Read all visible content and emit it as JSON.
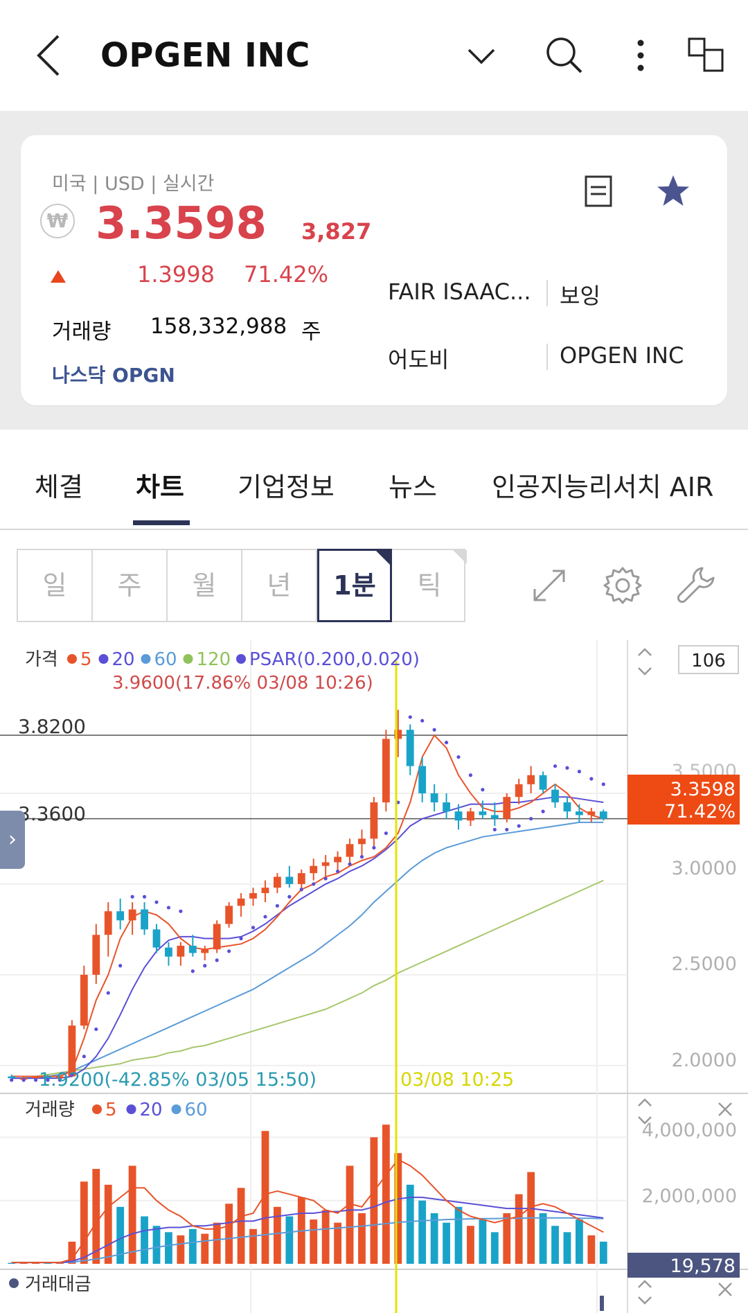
{
  "header": {
    "title": "OPGEN INC",
    "icons": [
      "back-arrow-icon",
      "chevron-down-icon",
      "search-icon",
      "more-vertical-icon",
      "window-switch-icon"
    ]
  },
  "quote": {
    "market": "미국 | USD | 실시간",
    "currency_badge": "₩",
    "price": "3.3598",
    "price_krw": "3,827",
    "change": "1.3998",
    "change_pct": "71.42%",
    "volume_label": "거래량",
    "volume": "158,332,988",
    "volume_unit": "주",
    "exchange_ticker": "나스닥 OPGN",
    "up_color": "#d8434c"
  },
  "related": [
    "FAIR ISAAC...",
    "보잉",
    "어도비",
    "OPGEN INC"
  ],
  "tabs": [
    {
      "label": "체결",
      "active": false
    },
    {
      "label": "차트",
      "active": true
    },
    {
      "label": "기업정보",
      "active": false
    },
    {
      "label": "뉴스",
      "active": false
    },
    {
      "label": "인공지능리서치 AIR",
      "active": false
    }
  ],
  "periods": [
    {
      "label": "일",
      "active": false
    },
    {
      "label": "주",
      "active": false
    },
    {
      "label": "월",
      "active": false
    },
    {
      "label": "년",
      "active": false
    },
    {
      "label": "1분",
      "active": true
    },
    {
      "label": "틱",
      "active": false
    }
  ],
  "chart_data": {
    "type": "candlestick",
    "price_panel": {
      "label": "가격",
      "legend": [
        {
          "name": "5",
          "color": "#e8542a"
        },
        {
          "name": "20",
          "color": "#5a4fd6"
        },
        {
          "name": "60",
          "color": "#5a9bd8"
        },
        {
          "name": "120",
          "color": "#8fc25a"
        },
        {
          "name": "PSAR(0.200,0.020)",
          "color": "#5a4fd6"
        }
      ],
      "high_marker": "3.9600(17.86% 03/08 10:26)",
      "low_marker": "1.9200(-42.85% 03/05 15:50)",
      "crosshair_time": "03/08 10:25",
      "hline_labels": [
        "3.8200",
        "3.3600"
      ],
      "y_ticks": [
        "3.5000",
        "3.0000",
        "2.5000",
        "2.0000"
      ],
      "ylim": [
        1.9,
        4.0
      ],
      "current_price": "3.3598",
      "current_pct": "71.42%",
      "bar_count": "106",
      "ma5": [
        1.94,
        1.94,
        1.94,
        1.94,
        1.94,
        1.97,
        2.15,
        2.36,
        2.5,
        2.7,
        2.82,
        2.85,
        2.83,
        2.78,
        2.7,
        2.65,
        2.64,
        2.65,
        2.66,
        2.67,
        2.7,
        2.75,
        2.82,
        2.9,
        2.97,
        3.0,
        3.04,
        3.06,
        3.1,
        3.13,
        3.15,
        3.2,
        3.28,
        3.45,
        3.7,
        3.82,
        3.75,
        3.6,
        3.5,
        3.42,
        3.4,
        3.4,
        3.42,
        3.45,
        3.5,
        3.55,
        3.5,
        3.42,
        3.38,
        3.36
      ],
      "ma20": [
        1.93,
        1.93,
        1.93,
        1.93,
        1.93,
        1.94,
        1.98,
        2.05,
        2.15,
        2.28,
        2.42,
        2.54,
        2.63,
        2.69,
        2.71,
        2.71,
        2.7,
        2.7,
        2.7,
        2.71,
        2.74,
        2.78,
        2.83,
        2.88,
        2.92,
        2.96,
        3.0,
        3.03,
        3.07,
        3.1,
        3.14,
        3.19,
        3.25,
        3.32,
        3.36,
        3.38,
        3.4,
        3.42,
        3.44,
        3.44,
        3.44,
        3.45,
        3.45,
        3.46,
        3.47,
        3.48,
        3.48,
        3.47,
        3.46,
        3.45
      ],
      "ma60": [
        1.93,
        1.93,
        1.93,
        1.94,
        1.95,
        1.97,
        2.0,
        2.03,
        2.06,
        2.09,
        2.12,
        2.15,
        2.18,
        2.21,
        2.24,
        2.27,
        2.3,
        2.33,
        2.36,
        2.39,
        2.42,
        2.46,
        2.5,
        2.54,
        2.58,
        2.62,
        2.67,
        2.72,
        2.77,
        2.83,
        2.9,
        2.96,
        3.02,
        3.08,
        3.13,
        3.17,
        3.2,
        3.22,
        3.24,
        3.26,
        3.27,
        3.28,
        3.29,
        3.3,
        3.31,
        3.32,
        3.33,
        3.34,
        3.34,
        3.34
      ],
      "ma120": [
        1.93,
        1.93,
        1.94,
        1.95,
        1.96,
        1.97,
        1.98,
        1.99,
        2.0,
        2.01,
        2.03,
        2.04,
        2.05,
        2.07,
        2.08,
        2.1,
        2.11,
        2.13,
        2.15,
        2.17,
        2.19,
        2.21,
        2.23,
        2.25,
        2.27,
        2.29,
        2.31,
        2.34,
        2.37,
        2.4,
        2.44,
        2.47,
        2.51,
        2.54,
        2.57,
        2.6,
        2.63,
        2.66,
        2.69,
        2.72,
        2.75,
        2.78,
        2.81,
        2.84,
        2.87,
        2.9,
        2.93,
        2.96,
        2.99,
        3.02
      ],
      "candles": [
        [
          1.94,
          1.95,
          1.93,
          1.93
        ],
        [
          1.93,
          1.94,
          1.92,
          1.93
        ],
        [
          1.93,
          1.94,
          1.93,
          1.94
        ],
        [
          1.94,
          1.95,
          1.93,
          1.93
        ],
        [
          1.93,
          1.94,
          1.92,
          1.94
        ],
        [
          1.94,
          2.25,
          1.94,
          2.22
        ],
        [
          2.22,
          2.55,
          2.2,
          2.5
        ],
        [
          2.5,
          2.78,
          2.45,
          2.72
        ],
        [
          2.72,
          2.9,
          2.6,
          2.85
        ],
        [
          2.85,
          2.92,
          2.75,
          2.8
        ],
        [
          2.8,
          2.9,
          2.72,
          2.86
        ],
        [
          2.86,
          2.9,
          2.72,
          2.75
        ],
        [
          2.75,
          2.78,
          2.62,
          2.65
        ],
        [
          2.65,
          2.68,
          2.55,
          2.6
        ],
        [
          2.6,
          2.68,
          2.55,
          2.66
        ],
        [
          2.66,
          2.72,
          2.6,
          2.62
        ],
        [
          2.62,
          2.66,
          2.58,
          2.64
        ],
        [
          2.64,
          2.8,
          2.62,
          2.78
        ],
        [
          2.78,
          2.9,
          2.76,
          2.88
        ],
        [
          2.88,
          2.95,
          2.82,
          2.92
        ],
        [
          2.92,
          2.98,
          2.88,
          2.95
        ],
        [
          2.95,
          3.02,
          2.9,
          2.98
        ],
        [
          2.98,
          3.06,
          2.95,
          3.04
        ],
        [
          3.04,
          3.1,
          2.98,
          3.0
        ],
        [
          3.0,
          3.08,
          2.96,
          3.06
        ],
        [
          3.06,
          3.14,
          3.02,
          3.1
        ],
        [
          3.1,
          3.16,
          3.04,
          3.12
        ],
        [
          3.12,
          3.18,
          3.06,
          3.15
        ],
        [
          3.15,
          3.25,
          3.1,
          3.22
        ],
        [
          3.22,
          3.3,
          3.15,
          3.25
        ],
        [
          3.25,
          3.48,
          3.2,
          3.45
        ],
        [
          3.45,
          3.85,
          3.4,
          3.8
        ],
        [
          3.8,
          3.96,
          3.7,
          3.85
        ],
        [
          3.85,
          3.88,
          3.6,
          3.65
        ],
        [
          3.65,
          3.7,
          3.45,
          3.5
        ],
        [
          3.5,
          3.55,
          3.4,
          3.45
        ],
        [
          3.45,
          3.5,
          3.36,
          3.4
        ],
        [
          3.4,
          3.44,
          3.3,
          3.35
        ],
        [
          3.35,
          3.42,
          3.32,
          3.4
        ],
        [
          3.4,
          3.46,
          3.36,
          3.38
        ],
        [
          3.38,
          3.45,
          3.32,
          3.36
        ],
        [
          3.36,
          3.5,
          3.34,
          3.48
        ],
        [
          3.48,
          3.58,
          3.44,
          3.55
        ],
        [
          3.55,
          3.65,
          3.5,
          3.6
        ],
        [
          3.6,
          3.62,
          3.5,
          3.52
        ],
        [
          3.52,
          3.55,
          3.42,
          3.45
        ],
        [
          3.45,
          3.48,
          3.36,
          3.4
        ],
        [
          3.4,
          3.44,
          3.34,
          3.38
        ],
        [
          3.38,
          3.42,
          3.34,
          3.4
        ],
        [
          3.4,
          3.41,
          3.35,
          3.36
        ]
      ],
      "psar": [
        1.92,
        1.92,
        1.92,
        1.92,
        1.92,
        1.95,
        2.05,
        2.2,
        2.4,
        2.55,
        2.93,
        2.93,
        2.9,
        2.87,
        2.85,
        2.52,
        2.55,
        2.58,
        2.63,
        2.7,
        2.76,
        2.82,
        2.88,
        2.93,
        2.97,
        3.0,
        3.03,
        3.07,
        3.11,
        3.15,
        3.2,
        3.28,
        3.45,
        3.92,
        3.9,
        3.85,
        3.78,
        3.7,
        3.6,
        3.52,
        3.3,
        3.3,
        3.32,
        3.36,
        3.4,
        3.65,
        3.64,
        3.62,
        3.58,
        3.55
      ]
    },
    "volume_panel": {
      "label": "거래량",
      "legend": [
        {
          "name": "5",
          "color": "#e8542a"
        },
        {
          "name": "20",
          "color": "#5a4fd6"
        },
        {
          "name": "60",
          "color": "#5a9bd8"
        }
      ],
      "y_ticks": [
        "4,000,000",
        "2,000,000"
      ],
      "ylim": [
        0,
        4600000
      ],
      "current": "19,578",
      "volumes": [
        30000,
        40000,
        30000,
        50000,
        40000,
        700000,
        2600000,
        3000000,
        2500000,
        1800000,
        3100000,
        1500000,
        1200000,
        1000000,
        900000,
        1100000,
        950000,
        1300000,
        1900000,
        2400000,
        1100000,
        4200000,
        1800000,
        1500000,
        2100000,
        1400000,
        1700000,
        1300000,
        3100000,
        1600000,
        4000000,
        4400000,
        3500000,
        2500000,
        2000000,
        1600000,
        1300000,
        1800000,
        1200000,
        1400000,
        1000000,
        1600000,
        2200000,
        2900000,
        1600000,
        1200000,
        1000000,
        1400000,
        900000,
        700000
      ],
      "ma5": [
        40000,
        40000,
        40000,
        40000,
        40000,
        150000,
        700000,
        1300000,
        1800000,
        2100000,
        2400000,
        2400000,
        2000000,
        1700000,
        1500000,
        1200000,
        1100000,
        1100000,
        1200000,
        1500000,
        1600000,
        2200000,
        2300000,
        2200000,
        2100000,
        2000000,
        1700000,
        1600000,
        1900000,
        1800000,
        2300000,
        2800000,
        3300000,
        3100000,
        2800000,
        2400000,
        2000000,
        1700000,
        1500000,
        1400000,
        1300000,
        1400000,
        1500000,
        1800000,
        1900000,
        1800000,
        1600000,
        1400000,
        1200000,
        1000000
      ],
      "ma20": [
        40000,
        40000,
        40000,
        40000,
        40000,
        80000,
        200000,
        400000,
        600000,
        800000,
        950000,
        1050000,
        1100000,
        1150000,
        1150000,
        1200000,
        1200000,
        1250000,
        1300000,
        1350000,
        1350000,
        1450000,
        1500000,
        1550000,
        1600000,
        1600000,
        1650000,
        1650000,
        1700000,
        1700000,
        1800000,
        1950000,
        2050000,
        2100000,
        2100000,
        2050000,
        2000000,
        1950000,
        1900000,
        1850000,
        1800000,
        1750000,
        1750000,
        1750000,
        1700000,
        1650000,
        1600000,
        1550000,
        1500000,
        1450000
      ],
      "ma60": [
        40000,
        40000,
        40000,
        40000,
        40000,
        50000,
        100000,
        150000,
        220000,
        300000,
        380000,
        450000,
        520000,
        580000,
        630000,
        680000,
        720000,
        760000,
        800000,
        840000,
        880000,
        920000,
        960000,
        1000000,
        1040000,
        1070000,
        1100000,
        1130000,
        1160000,
        1190000,
        1230000,
        1270000,
        1310000,
        1340000,
        1360000,
        1380000,
        1400000,
        1410000,
        1420000,
        1430000,
        1430000,
        1440000,
        1440000,
        1450000,
        1450000,
        1450000,
        1450000,
        1440000,
        1440000,
        1430000
      ]
    },
    "amount_panel": {
      "label": "거래대금"
    }
  }
}
